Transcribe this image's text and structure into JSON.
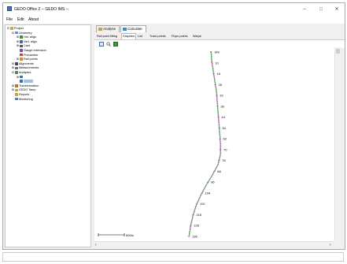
{
  "window": {
    "title": "GEDO Office 2 -- GEDO IMS --"
  },
  "window_controls": {
    "minimize": "–",
    "maximize": "□",
    "close": "✕"
  },
  "menu": [
    {
      "label": "File"
    },
    {
      "label": "Edit"
    },
    {
      "label": "About"
    }
  ],
  "tree": [
    {
      "label": "Project",
      "expander": "⊟",
      "icon": "project-icon",
      "color": "#c9a24a",
      "level": 0
    },
    {
      "label": "Geometry",
      "expander": "⊟",
      "icon": "geometry-icon",
      "color": "#6a8fc0",
      "level": 1
    },
    {
      "label": "Hor. align",
      "expander": "⊞",
      "icon": "hor-align-icon",
      "color": "#3b8a3b",
      "level": 2
    },
    {
      "label": "Vert. align",
      "expander": "⊞",
      "icon": "vert-align-icon",
      "color": "#3b6aa8",
      "level": 2
    },
    {
      "label": "Cant",
      "expander": "⊞",
      "icon": "cant-icon",
      "color": "#555555",
      "level": 2
    },
    {
      "label": "Gauge extension",
      "expander": "",
      "icon": "gauge-icon",
      "color": "#7c4fa8",
      "level": 2
    },
    {
      "label": "Precamber",
      "expander": "",
      "icon": "precamber-icon",
      "color": "#b04a4a",
      "level": 2
    },
    {
      "label": "Rail points",
      "expander": "⊞",
      "icon": "rail-points-icon",
      "color": "#d08a2a",
      "level": 2
    },
    {
      "label": "Alignments",
      "expander": "⊞",
      "icon": "alignments-icon",
      "color": "#4a4a4a",
      "level": 1
    },
    {
      "label": "Measurements",
      "expander": "⊞",
      "icon": "measurements-icon",
      "color": "#6a6a9a",
      "level": 1
    },
    {
      "label": "Analyses",
      "expander": "⊟",
      "icon": "analyses-icon",
      "color": "#5a8a5a",
      "level": 1
    },
    {
      "label": "",
      "expander": "⊞",
      "icon": "analysis-item-icon",
      "color": "#3b6aa8",
      "level": 2
    },
    {
      "label": "",
      "expander": "",
      "icon": "analysis-selected-icon",
      "color": "#3b6aa8",
      "level": 2,
      "selected": true
    },
    {
      "label": "Transformation",
      "expander": "⊞",
      "icon": "transformation-icon",
      "color": "#b07a2a",
      "level": 1
    },
    {
      "label": "GEDO Tamp",
      "expander": "⊞",
      "icon": "tamp-icon",
      "color": "#c9a24a",
      "level": 1
    },
    {
      "label": "Reports",
      "expander": "",
      "icon": "reports-icon",
      "color": "#c9a24a",
      "level": 1
    },
    {
      "label": "Monitoring",
      "expander": "",
      "icon": "monitoring-icon",
      "color": "#5a7aa8",
      "level": 1
    }
  ],
  "top_tabs": [
    {
      "label": "Analyse",
      "icon": "analyse-tab-icon",
      "color": "#d0a030"
    },
    {
      "label": "Calculate",
      "icon": "calculate-tab-icon",
      "color": "#3b8ac0"
    }
  ],
  "sub_tabs": [
    {
      "label": "Rail point fitting",
      "selected": false
    },
    {
      "label": "Graphics",
      "selected": true
    },
    {
      "label": "List",
      "selected": false
    },
    {
      "label": "Track points",
      "selected": false
    },
    {
      "label": "Fixpo points",
      "selected": false
    },
    {
      "label": "Warps",
      "selected": false
    }
  ],
  "toolbar": [
    {
      "icon": "select-tool-icon"
    },
    {
      "icon": "zoom-tool-icon"
    },
    {
      "icon": "export-tool-icon"
    }
  ],
  "graphic": {
    "scale_label": "500m",
    "station_labels": [
      "148",
      "10",
      "18",
      "26",
      "32",
      "36",
      "44",
      "54",
      "62",
      "70",
      "78",
      "88",
      "96",
      "104",
      "110",
      "118",
      "128",
      "136"
    ],
    "colors": {
      "track_line": "#3a9a3a",
      "marks": "#c03ac0",
      "bg": "#ffffff"
    }
  }
}
